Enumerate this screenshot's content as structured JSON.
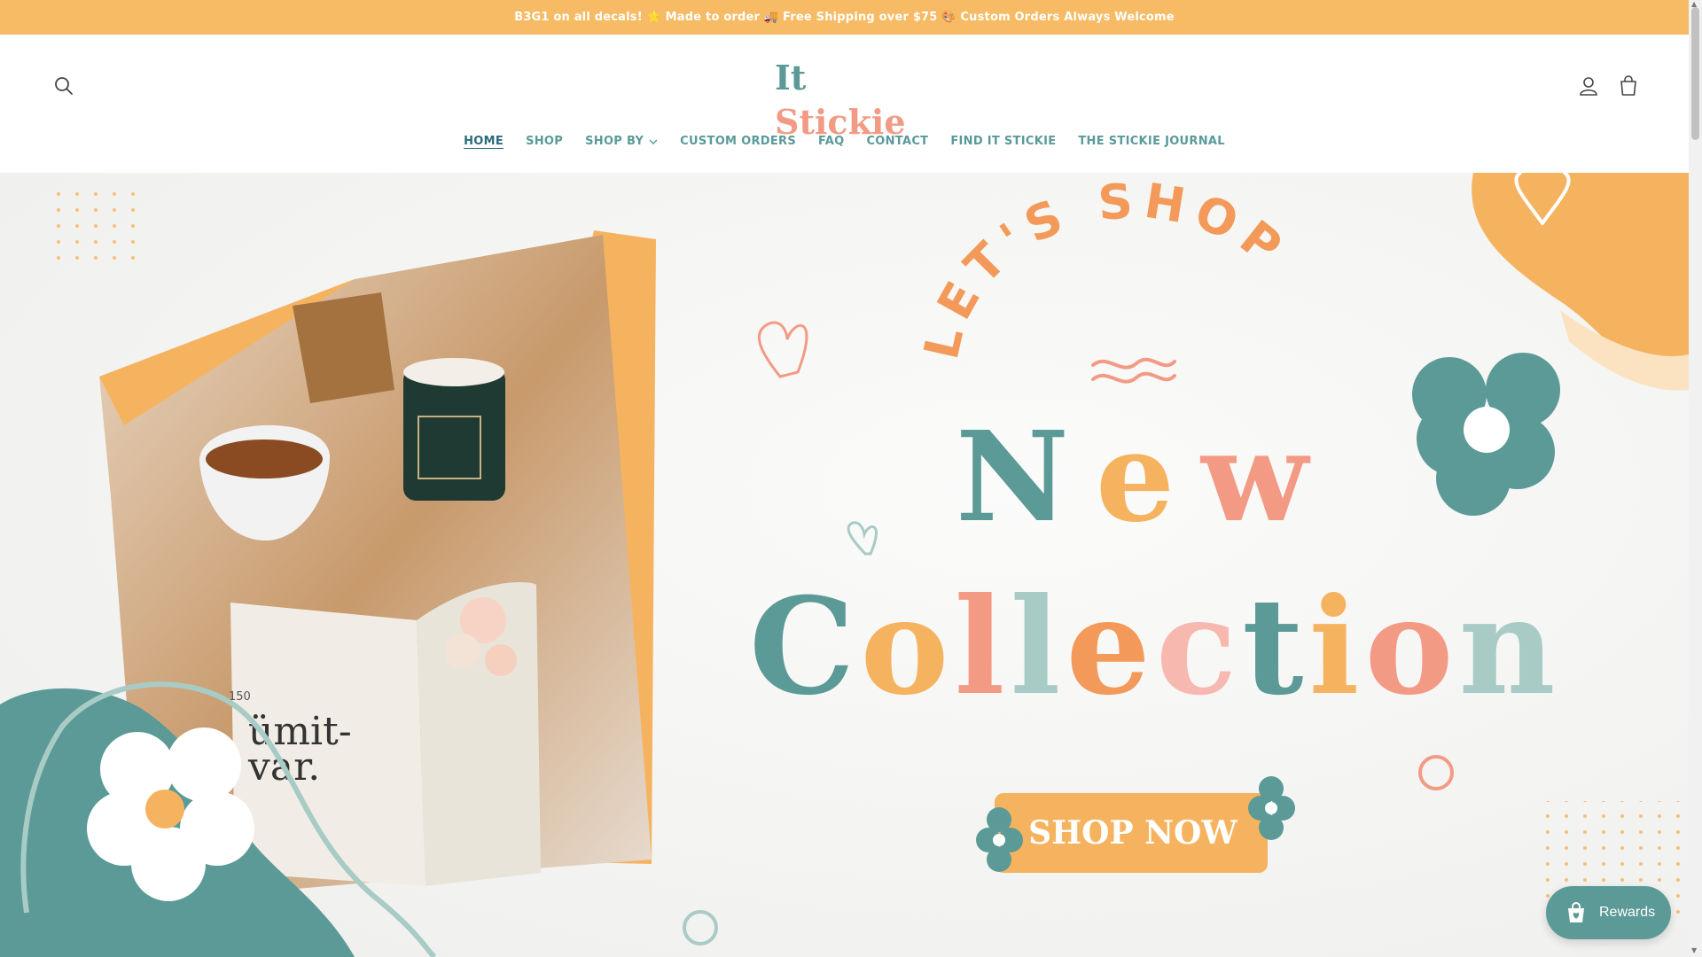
{
  "announcement": "B3G1 on all decals! ⭐ Made to order 🚚 Free Shipping over $75 🎨 Custom Orders Always Welcome",
  "logo": {
    "part1": "It",
    "part2": "Stickie"
  },
  "nav": [
    {
      "label": "HOME",
      "active": true
    },
    {
      "label": "SHOP"
    },
    {
      "label": "SHOP BY",
      "dropdown": true
    },
    {
      "label": "CUSTOM ORDERS"
    },
    {
      "label": "FAQ"
    },
    {
      "label": "CONTACT"
    },
    {
      "label": "FIND IT STICKIE"
    },
    {
      "label": "THE STICKIE JOURNAL"
    }
  ],
  "hero": {
    "tagline": "LET'S SHOP",
    "headline1": "New",
    "headline2": "Collection",
    "cta": "SHOP NOW",
    "book_page_number": "150",
    "book_text_1": "ümit-",
    "book_text_2": "var."
  },
  "rewards": {
    "label": "Rewards"
  },
  "colors": {
    "announcement_bg": "#f6bb64",
    "teal": "#5b9a96",
    "orange": "#f6b35f",
    "salmon": "#f39a85",
    "pink": "#f7b8b0",
    "mint": "#a8cbc6"
  }
}
